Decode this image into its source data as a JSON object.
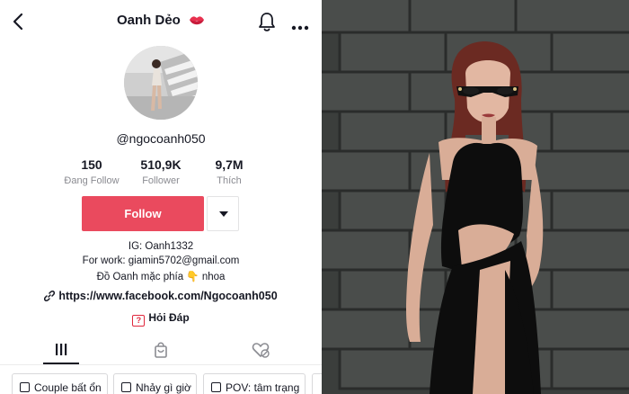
{
  "header": {
    "title": "Oanh Dẻo"
  },
  "icons": {
    "back": "chevron-left-icon",
    "title_emoji": "lips-icon",
    "bell": "bell-icon",
    "more": "more-dots-icon"
  },
  "profile": {
    "username": "@ngocoanh050",
    "stats": [
      {
        "value": "150",
        "label": "Đang Follow"
      },
      {
        "value": "510,9K",
        "label": "Follower"
      },
      {
        "value": "9,7M",
        "label": "Thích"
      }
    ],
    "follow_label": "Follow",
    "bio_lines": [
      "IG: Oanh1332",
      "For work: giamin5702@gmail.com",
      "Đồ Oanh mặc phía 👇 nhoa"
    ],
    "link": "https://www.facebook.com/Ngocoanh050",
    "qa_label": "Hỏi Đáp"
  },
  "tabs": [
    {
      "name": "videos",
      "icon": "grid-icon",
      "active": true
    },
    {
      "name": "shop",
      "icon": "shopping-bag-icon",
      "active": false
    },
    {
      "name": "liked",
      "icon": "heart-hidden-icon",
      "active": false
    }
  ],
  "playlists": [
    "Couple bất ổn",
    "Nhảy gì giờ",
    "POV: tâm trạng"
  ],
  "colors": {
    "accent": "#ea4a5e",
    "text": "#161823",
    "muted": "#8a8b91"
  }
}
